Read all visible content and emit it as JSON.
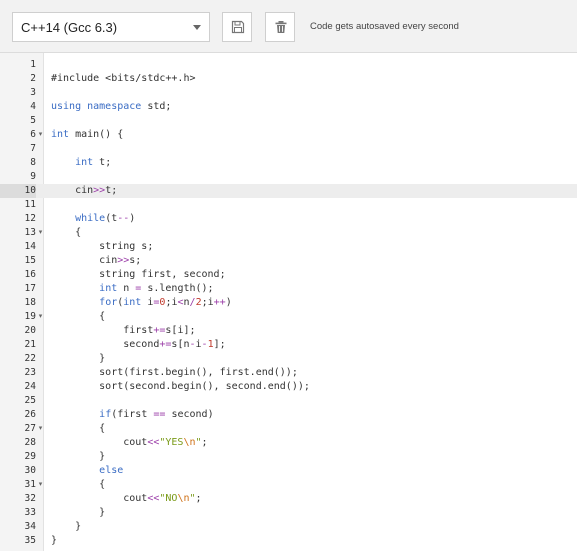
{
  "toolbar": {
    "language": "C++14 (Gcc 6.3)",
    "autosave_note": "Code gets autosaved every second"
  },
  "colors": {
    "keyword": "#3a6cc4",
    "operator": "#9b3ea8",
    "number": "#c0392b",
    "string": "#7a9a18",
    "escape": "#d0731b",
    "text": "#333333",
    "active_line": "#ededed"
  },
  "icons": {
    "save": "floppy-disk-icon",
    "delete": "trash-icon",
    "fold": "fold-arrow-icon"
  },
  "editor": {
    "active_line": 10,
    "lines": [
      {
        "n": "1",
        "tokens": []
      },
      {
        "n": "2",
        "tokens": [
          {
            "t": "#include <bits/stdc++.h>",
            "c": "text"
          }
        ]
      },
      {
        "n": "3",
        "tokens": []
      },
      {
        "n": "4",
        "tokens": [
          {
            "t": "using namespace",
            "c": "kw"
          },
          {
            "t": " std;",
            "c": "text"
          }
        ]
      },
      {
        "n": "5",
        "tokens": []
      },
      {
        "n": "6",
        "fold": true,
        "tokens": [
          {
            "t": "int",
            "c": "kw"
          },
          {
            "t": " main() {",
            "c": "text"
          }
        ]
      },
      {
        "n": "7",
        "tokens": []
      },
      {
        "n": "8",
        "tokens": [
          {
            "t": "    ",
            "c": "text"
          },
          {
            "t": "int",
            "c": "kw"
          },
          {
            "t": " t;",
            "c": "text"
          }
        ]
      },
      {
        "n": "9",
        "tokens": []
      },
      {
        "n": "10",
        "tokens": [
          {
            "t": "    cin",
            "c": "text"
          },
          {
            "t": ">>",
            "c": "op"
          },
          {
            "t": "t;",
            "c": "text"
          }
        ]
      },
      {
        "n": "11",
        "tokens": []
      },
      {
        "n": "12",
        "tokens": [
          {
            "t": "    ",
            "c": "text"
          },
          {
            "t": "while",
            "c": "kw"
          },
          {
            "t": "(t",
            "c": "text"
          },
          {
            "t": "--",
            "c": "op"
          },
          {
            "t": ")",
            "c": "text"
          }
        ]
      },
      {
        "n": "13",
        "fold": true,
        "tokens": [
          {
            "t": "    {",
            "c": "text"
          }
        ]
      },
      {
        "n": "14",
        "tokens": [
          {
            "t": "        string s;",
            "c": "text"
          }
        ]
      },
      {
        "n": "15",
        "tokens": [
          {
            "t": "        cin",
            "c": "text"
          },
          {
            "t": ">>",
            "c": "op"
          },
          {
            "t": "s;",
            "c": "text"
          }
        ]
      },
      {
        "n": "16",
        "tokens": [
          {
            "t": "        string first, second;",
            "c": "text"
          }
        ]
      },
      {
        "n": "17",
        "tokens": [
          {
            "t": "        ",
            "c": "text"
          },
          {
            "t": "int",
            "c": "kw"
          },
          {
            "t": " n ",
            "c": "text"
          },
          {
            "t": "=",
            "c": "op"
          },
          {
            "t": " s.length();",
            "c": "text"
          }
        ]
      },
      {
        "n": "18",
        "tokens": [
          {
            "t": "        ",
            "c": "text"
          },
          {
            "t": "for",
            "c": "kw"
          },
          {
            "t": "(",
            "c": "text"
          },
          {
            "t": "int",
            "c": "kw"
          },
          {
            "t": " i",
            "c": "text"
          },
          {
            "t": "=",
            "c": "op"
          },
          {
            "t": "0",
            "c": "num"
          },
          {
            "t": ";i",
            "c": "text"
          },
          {
            "t": "<",
            "c": "op"
          },
          {
            "t": "n",
            "c": "text"
          },
          {
            "t": "/",
            "c": "op"
          },
          {
            "t": "2",
            "c": "num"
          },
          {
            "t": ";i",
            "c": "text"
          },
          {
            "t": "++",
            "c": "op"
          },
          {
            "t": ")",
            "c": "text"
          }
        ]
      },
      {
        "n": "19",
        "fold": true,
        "tokens": [
          {
            "t": "        {",
            "c": "text"
          }
        ]
      },
      {
        "n": "20",
        "tokens": [
          {
            "t": "            first",
            "c": "text"
          },
          {
            "t": "+=",
            "c": "op"
          },
          {
            "t": "s[i];",
            "c": "text"
          }
        ]
      },
      {
        "n": "21",
        "tokens": [
          {
            "t": "            second",
            "c": "text"
          },
          {
            "t": "+=",
            "c": "op"
          },
          {
            "t": "s[n",
            "c": "text"
          },
          {
            "t": "-",
            "c": "op"
          },
          {
            "t": "i",
            "c": "text"
          },
          {
            "t": "-",
            "c": "op"
          },
          {
            "t": "1",
            "c": "num"
          },
          {
            "t": "];",
            "c": "text"
          }
        ]
      },
      {
        "n": "22",
        "tokens": [
          {
            "t": "        }",
            "c": "text"
          }
        ]
      },
      {
        "n": "23",
        "tokens": [
          {
            "t": "        sort(first.begin(), first.end());",
            "c": "text"
          }
        ]
      },
      {
        "n": "24",
        "tokens": [
          {
            "t": "        sort(second.begin(), second.end());",
            "c": "text"
          }
        ]
      },
      {
        "n": "25",
        "tokens": []
      },
      {
        "n": "26",
        "tokens": [
          {
            "t": "        ",
            "c": "text"
          },
          {
            "t": "if",
            "c": "kw"
          },
          {
            "t": "(first ",
            "c": "text"
          },
          {
            "t": "==",
            "c": "op"
          },
          {
            "t": " second)",
            "c": "text"
          }
        ]
      },
      {
        "n": "27",
        "fold": true,
        "tokens": [
          {
            "t": "        {",
            "c": "text"
          }
        ]
      },
      {
        "n": "28",
        "tokens": [
          {
            "t": "            cout",
            "c": "text"
          },
          {
            "t": "<<",
            "c": "op"
          },
          {
            "t": "\"YES",
            "c": "str"
          },
          {
            "t": "\\n",
            "c": "esc"
          },
          {
            "t": "\"",
            "c": "str"
          },
          {
            "t": ";",
            "c": "text"
          }
        ]
      },
      {
        "n": "29",
        "tokens": [
          {
            "t": "        }",
            "c": "text"
          }
        ]
      },
      {
        "n": "30",
        "tokens": [
          {
            "t": "        ",
            "c": "text"
          },
          {
            "t": "else",
            "c": "kw"
          }
        ]
      },
      {
        "n": "31",
        "fold": true,
        "tokens": [
          {
            "t": "        {",
            "c": "text"
          }
        ]
      },
      {
        "n": "32",
        "tokens": [
          {
            "t": "            cout",
            "c": "text"
          },
          {
            "t": "<<",
            "c": "op"
          },
          {
            "t": "\"NO",
            "c": "str"
          },
          {
            "t": "\\n",
            "c": "esc"
          },
          {
            "t": "\"",
            "c": "str"
          },
          {
            "t": ";",
            "c": "text"
          }
        ]
      },
      {
        "n": "33",
        "tokens": [
          {
            "t": "        }",
            "c": "text"
          }
        ]
      },
      {
        "n": "34",
        "tokens": [
          {
            "t": "    }",
            "c": "text"
          }
        ]
      },
      {
        "n": "35",
        "tokens": [
          {
            "t": "}",
            "c": "text"
          }
        ]
      }
    ]
  }
}
